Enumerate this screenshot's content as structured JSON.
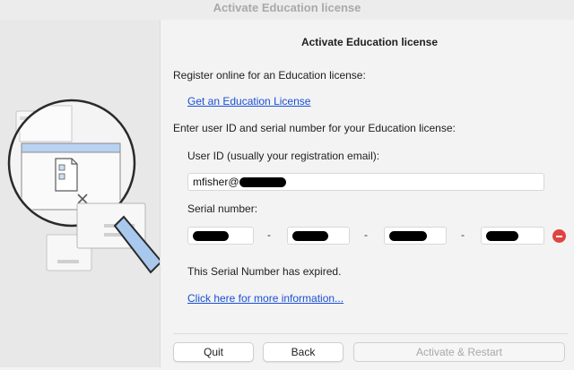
{
  "window": {
    "title": "Activate Education license"
  },
  "main": {
    "heading": "Activate Education license",
    "register_text": "Register online for an Education license:",
    "get_license_link": "Get an Education License",
    "enter_text": "Enter user ID and serial number for your Education license:",
    "user_id_label": "User ID (usually your registration email):",
    "user_id_value_visible": "mfisher@",
    "serial_label": "Serial number:",
    "serial_separators": [
      "-",
      "-",
      "-"
    ],
    "expired_text": "This Serial Number has expired.",
    "more_info_link": "Click here for more information..."
  },
  "buttons": {
    "quit": "Quit",
    "back": "Back",
    "activate": "Activate & Restart"
  },
  "icons": {
    "illustration": "magnifying-glass-over-document",
    "remove": "remove-circle-icon"
  },
  "colors": {
    "link": "#1a4fd6",
    "remove": "#e0443e",
    "magnifier_handle": "#a9c8ee"
  }
}
